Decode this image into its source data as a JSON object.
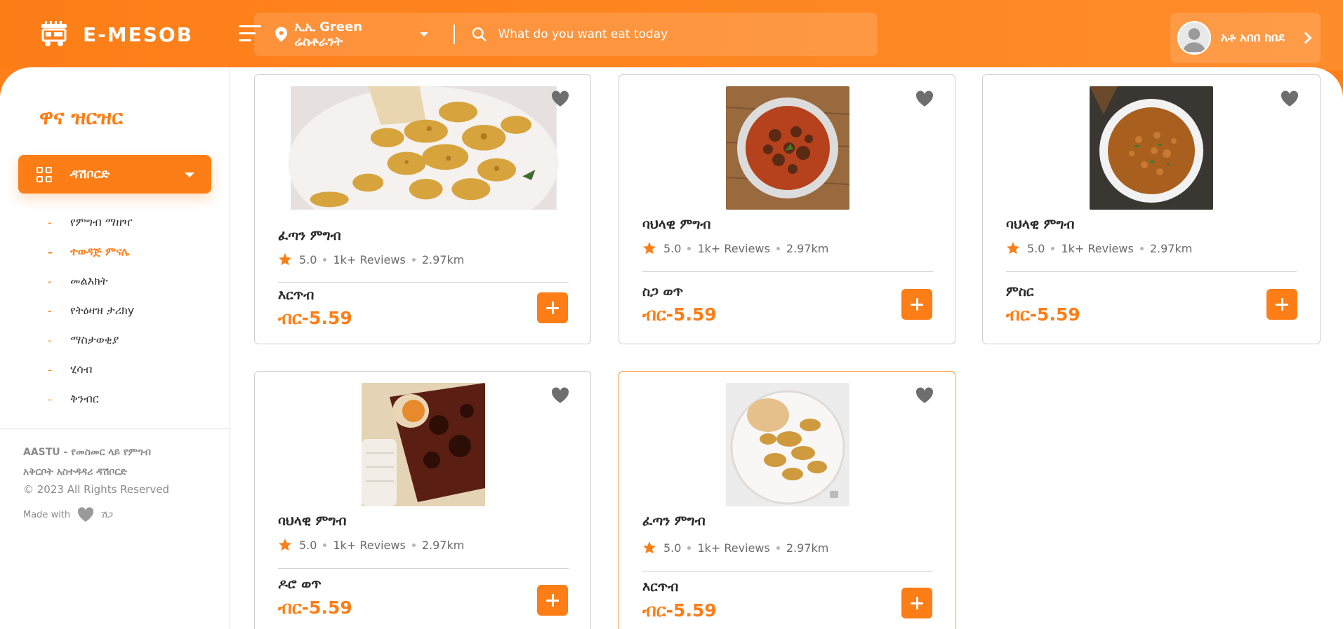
{
  "brand": {
    "name": "E-MESOB",
    "accent": "#fd7e17"
  },
  "header": {
    "location": "ኢኢ Green ሬስቶራንት",
    "search_placeholder": "What do you want eat today",
    "user_name": "አቶ አበበ ከበደ"
  },
  "sidebar": {
    "title": "ዋና ዝርዝር",
    "dashboard_label": "ዳሽቦርድ",
    "items": [
      {
        "label": "የምግብ ማዘዣ"
      },
      {
        "label": "ተወዳጅ ምናሌ",
        "active": true
      },
      {
        "label": "መልእክት"
      },
      {
        "label": "የትዕዛዝ ታሪክy"
      },
      {
        "label": "ማስታወቂያ"
      },
      {
        "label": "ሂሳብ"
      },
      {
        "label": "ቅንብር"
      }
    ],
    "footer": {
      "org_line1": "AASTU - የመስመር ላይ የምግብ",
      "org_line2": "አቅርቦት አስተዳዳሪ ዳሽቦርድ",
      "copyright": "© 2023 All Rights Reserved",
      "made_with": "Made with",
      "made_by": "ሽጋ"
    }
  },
  "cards": [
    {
      "category": "ፈጣን ምግብ",
      "rating": "5.0",
      "reviews": "1k+ Reviews",
      "distance": "2.97km",
      "dish": "እርጥብ",
      "price": "ብር-5.59",
      "image": "chips"
    },
    {
      "category": "ባህላዊ ምግብ",
      "rating": "5.0",
      "reviews": "1k+ Reviews",
      "distance": "2.97km",
      "dish": "ስጋ ወጥ",
      "price": "ብር-5.59",
      "image": "stew"
    },
    {
      "category": "ባህላዊ ምግብ",
      "rating": "5.0",
      "reviews": "1k+ Reviews",
      "distance": "2.97km",
      "dish": "ምስር",
      "price": "ብር-5.59",
      "image": "lentil"
    },
    {
      "category": "ባህላዊ ምግብ",
      "rating": "5.0",
      "reviews": "1k+ Reviews",
      "distance": "2.97km",
      "dish": "ዶሮ ወጥ",
      "price": "ብር-5.59",
      "image": "doro"
    },
    {
      "category": "ፈጣን ምግብ",
      "rating": "5.0",
      "reviews": "1k+ Reviews",
      "distance": "2.97km",
      "dish": "እርጥብ",
      "price": "ብር-5.59",
      "image": "chips-plate"
    }
  ]
}
